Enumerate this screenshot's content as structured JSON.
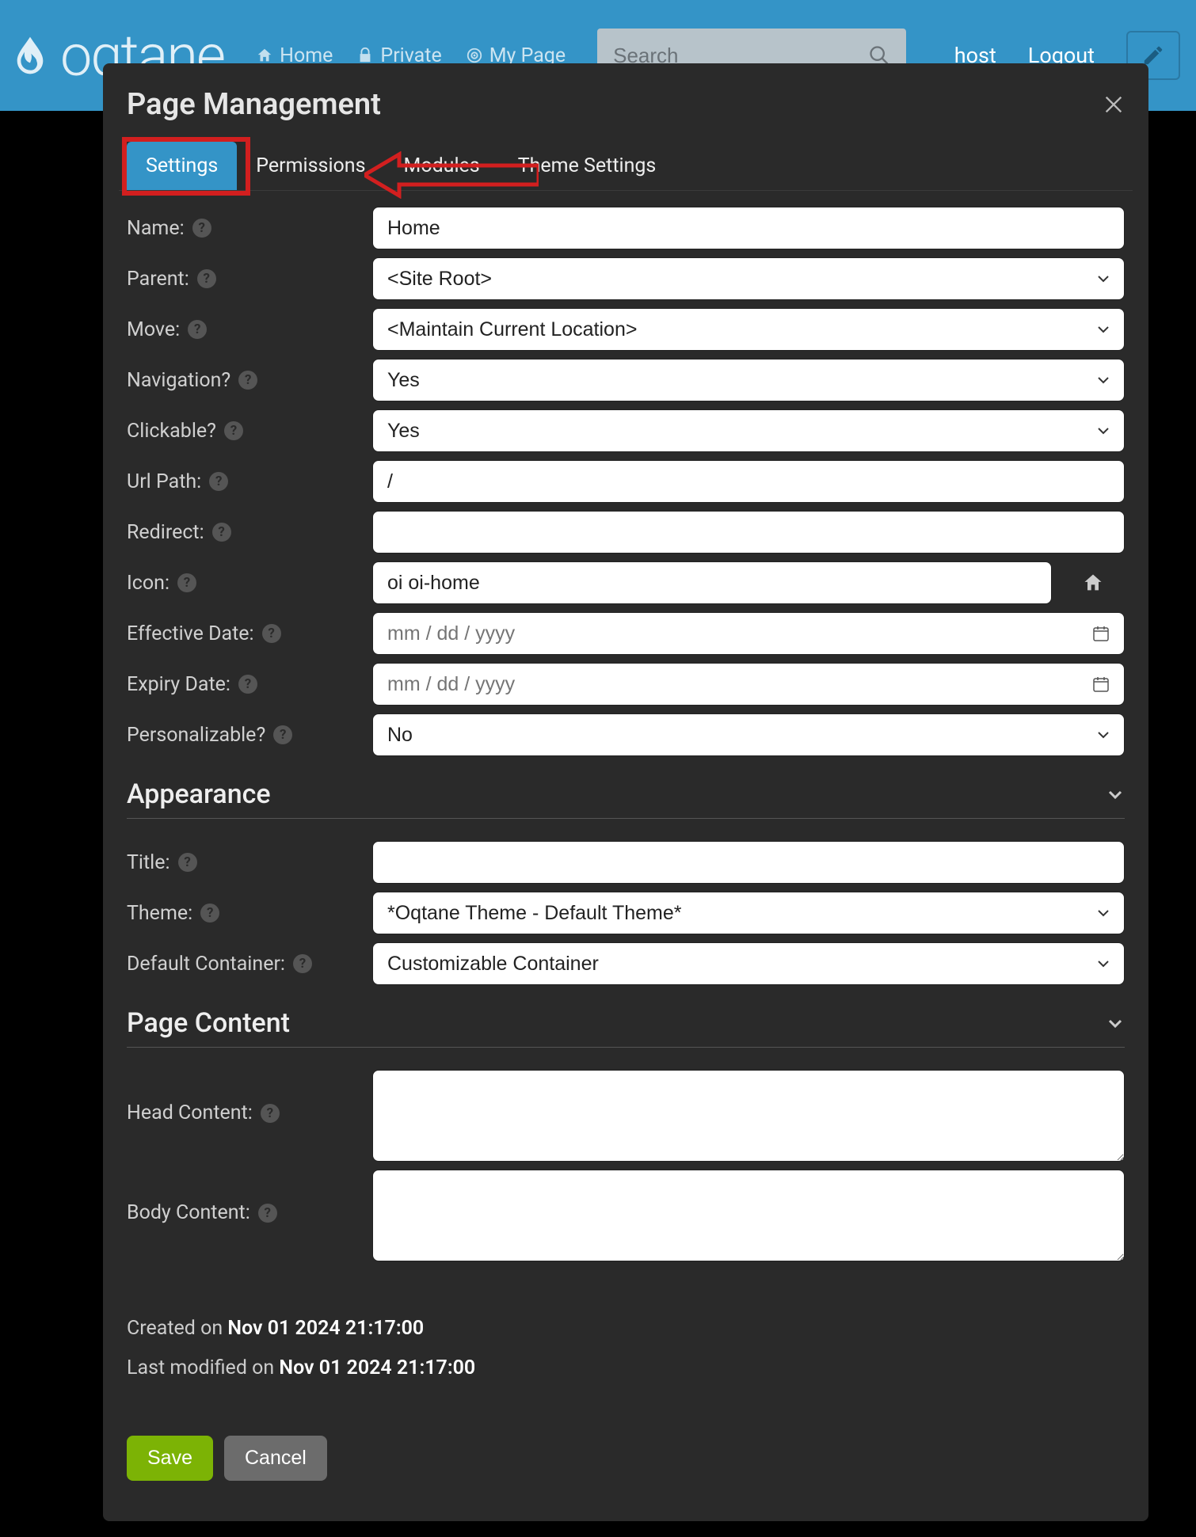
{
  "topbar": {
    "logo": "oqtane",
    "nav": {
      "home": "Home",
      "private": "Private",
      "mypage": "My Page"
    },
    "search_placeholder": "Search",
    "user": "host",
    "logout": "Logout"
  },
  "modal": {
    "title": "Page Management",
    "tabs": {
      "settings": "Settings",
      "permissions": "Permissions",
      "modules": "Modules",
      "theme": "Theme Settings"
    },
    "labels": {
      "name": "Name:",
      "parent": "Parent:",
      "move": "Move:",
      "navigation": "Navigation?",
      "clickable": "Clickable?",
      "urlpath": "Url Path:",
      "redirect": "Redirect:",
      "icon": "Icon:",
      "effective": "Effective Date:",
      "expiry": "Expiry Date:",
      "personalizable": "Personalizable?",
      "title": "Title:",
      "theme": "Theme:",
      "container": "Default Container:",
      "head": "Head Content:",
      "body": "Body Content:"
    },
    "values": {
      "name": "Home",
      "parent": "<Site Root>",
      "move": "<Maintain Current Location>",
      "navigation": "Yes",
      "clickable": "Yes",
      "urlpath": "/",
      "redirect": "",
      "icon": "oi oi-home",
      "date_placeholder": "mm / dd / yyyy",
      "personalizable": "No",
      "title": "",
      "theme": "*Oqtane Theme - Default Theme*",
      "container": "Customizable Container",
      "head": "",
      "body": ""
    },
    "sections": {
      "appearance": "Appearance",
      "pagecontent": "Page Content"
    },
    "meta": {
      "created_label": "Created on ",
      "created_value": "Nov 01 2024 21:17:00",
      "modified_label": "Last modified on ",
      "modified_value": "Nov 01 2024 21:17:00"
    },
    "buttons": {
      "save": "Save",
      "cancel": "Cancel"
    }
  }
}
